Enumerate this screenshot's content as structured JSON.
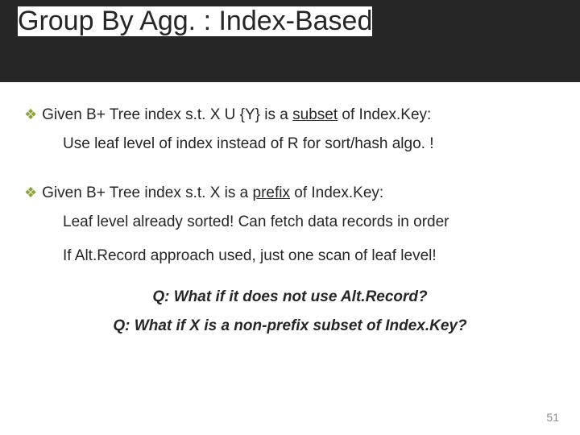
{
  "slide": {
    "title": "Group By Agg. : Index-Based",
    "bullet1": {
      "pre": "Given B+ Tree index s.t. X U {Y} is a ",
      "underlined": "subset",
      "post": " of Index.Key:"
    },
    "sub1": "Use leaf level of index instead of R for sort/hash algo. !",
    "bullet2": {
      "pre": "Given B+ Tree index s.t. X is a ",
      "underlined": "prefix",
      "post": " of Index.Key:"
    },
    "sub2a": "Leaf level already sorted! Can fetch data records in order",
    "sub2b": "If Alt.Record approach used, just one scan of leaf level!",
    "q1": "Q: What if it does not use Alt.Record?",
    "q2": "Q: What if X is a non-prefix subset of Index.Key?",
    "page": "51",
    "bullet_glyph": "❖"
  }
}
